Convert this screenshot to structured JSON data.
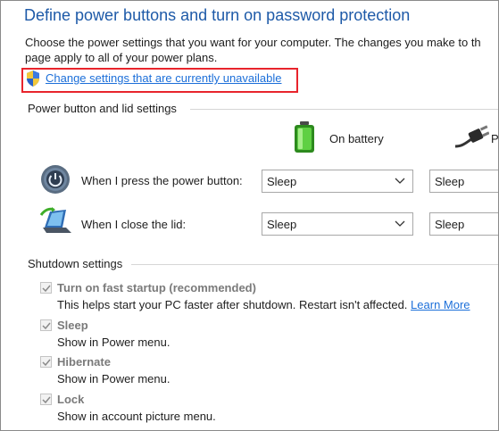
{
  "header": {
    "title": "Define power buttons and turn on password protection",
    "desc_line1": "Choose the power settings that you want for your computer. The changes you make to th",
    "desc_line2": "page apply to all of your power plans.",
    "change_link": "Change settings that are currently unavailable"
  },
  "power_section": {
    "title": "Power button and lid settings",
    "col_battery": "On battery",
    "col_plugged_partial": "P",
    "rows": [
      {
        "label": "When I press the power button:",
        "battery_value": "Sleep",
        "plugged_value": "Sleep"
      },
      {
        "label": "When I close the lid:",
        "battery_value": "Sleep",
        "plugged_value": "Sleep"
      }
    ]
  },
  "shutdown_section": {
    "title": "Shutdown settings",
    "items": [
      {
        "label": "Turn on fast startup (recommended)",
        "checked": true,
        "desc": "This helps start your PC faster after shutdown. Restart isn't affected.",
        "link": "Learn More"
      },
      {
        "label": "Sleep",
        "checked": true,
        "desc": "Show in Power menu."
      },
      {
        "label": "Hibernate",
        "checked": true,
        "desc": "Show in Power menu."
      },
      {
        "label": "Lock",
        "checked": true,
        "desc": "Show in account picture menu."
      }
    ]
  },
  "colors": {
    "title": "#1e5aa8",
    "link": "#1c6fd9",
    "highlight": "#e8242c",
    "battery": "#3fae2a"
  },
  "icons": [
    "uac-shield-icon",
    "battery-icon",
    "plug-icon",
    "power-button-icon",
    "laptop-lid-icon",
    "chevron-down-icon",
    "checkmark-icon"
  ]
}
